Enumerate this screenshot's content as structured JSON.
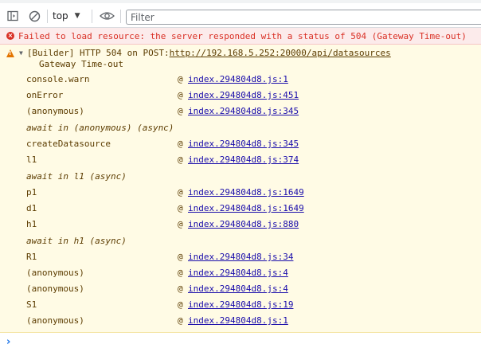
{
  "toolbar": {
    "context_label": "top",
    "filter_placeholder": "Filter"
  },
  "error": {
    "message": "Failed to load resource: the server responded with a status of 504 (Gateway Time-out)"
  },
  "warning": {
    "prefix": "[Builder] HTTP 504 on POST:",
    "url": "http://192.168.5.252:20000/api/datasources",
    "detail": "Gateway Time-out",
    "frames": [
      {
        "fn": "console.warn",
        "loc": "index.294804d8.js:1"
      },
      {
        "fn": "onError",
        "loc": "index.294804d8.js:451"
      },
      {
        "fn": "(anonymous)",
        "loc": "index.294804d8.js:345"
      },
      {
        "fn": "await in (anonymous) (async)",
        "loc": ""
      },
      {
        "fn": "createDatasource",
        "loc": "index.294804d8.js:345"
      },
      {
        "fn": "l1",
        "loc": "index.294804d8.js:374"
      },
      {
        "fn": "await in l1 (async)",
        "loc": ""
      },
      {
        "fn": "p1",
        "loc": "index.294804d8.js:1649"
      },
      {
        "fn": "d1",
        "loc": "index.294804d8.js:1649"
      },
      {
        "fn": "h1",
        "loc": "index.294804d8.js:880"
      },
      {
        "fn": "await in h1 (async)",
        "loc": ""
      },
      {
        "fn": "R1",
        "loc": "index.294804d8.js:34"
      },
      {
        "fn": "(anonymous)",
        "loc": "index.294804d8.js:4"
      },
      {
        "fn": "(anonymous)",
        "loc": "index.294804d8.js:4"
      },
      {
        "fn": "S1",
        "loc": "index.294804d8.js:19"
      },
      {
        "fn": "(anonymous)",
        "loc": "index.294804d8.js:1"
      }
    ],
    "at_symbol": "@"
  },
  "prompt": {
    "symbol": "›"
  },
  "colors": {
    "error": "#d93025",
    "warning_bg": "#fffbe5",
    "link": "#1a0dab",
    "prompt": "#1a73e8"
  }
}
